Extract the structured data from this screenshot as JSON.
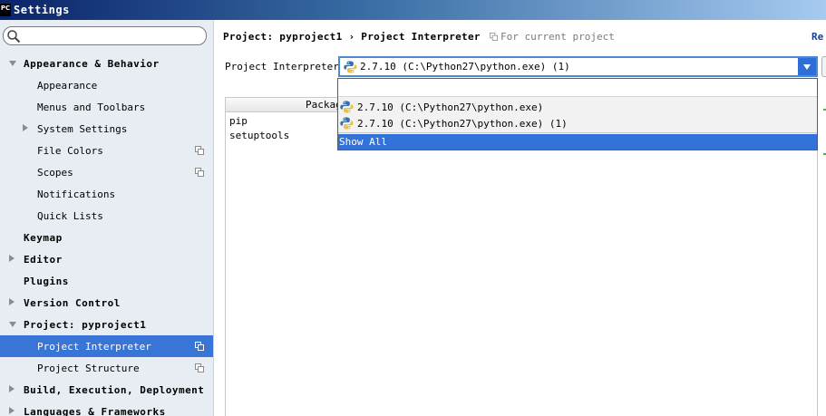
{
  "window": {
    "title": "Settings",
    "logo_text": "PC"
  },
  "sidebar": {
    "search": {
      "value": "",
      "placeholder": ""
    },
    "items": [
      {
        "label": "Appearance & Behavior",
        "level": 0,
        "expanded": true
      },
      {
        "label": "Appearance",
        "level": 1
      },
      {
        "label": "Menus and Toolbars",
        "level": 1
      },
      {
        "label": "System Settings",
        "level": 1,
        "collapsed": true
      },
      {
        "label": "File Colors",
        "level": 1,
        "project_scope": true
      },
      {
        "label": "Scopes",
        "level": 1,
        "project_scope": true
      },
      {
        "label": "Notifications",
        "level": 1
      },
      {
        "label": "Quick Lists",
        "level": 1
      },
      {
        "label": "Keymap",
        "level": 0
      },
      {
        "label": "Editor",
        "level": 0,
        "collapsed": true
      },
      {
        "label": "Plugins",
        "level": 0
      },
      {
        "label": "Version Control",
        "level": 0,
        "collapsed": true
      },
      {
        "label": "Project: pyproject1",
        "level": 0,
        "expanded": true
      },
      {
        "label": "Project Interpreter",
        "level": 1,
        "selected": true,
        "project_scope": true
      },
      {
        "label": "Project Structure",
        "level": 1,
        "project_scope": true
      },
      {
        "label": "Build, Execution, Deployment",
        "level": 0,
        "collapsed": true
      },
      {
        "label": "Languages & Frameworks",
        "level": 0,
        "collapsed": true
      }
    ]
  },
  "main": {
    "breadcrumb": "Project: pyproject1 › Project Interpreter",
    "scope_note": "For current project",
    "reset_label": "Re",
    "interpreter": {
      "label": "Project Interpreter:",
      "selected_value": "2.7.10 (C:\\Python27\\python.exe) (1)"
    },
    "dropdown": {
      "options": [
        "2.7.10 (C:\\Python27\\python.exe)",
        "2.7.10 (C:\\Python27\\python.exe) (1)"
      ],
      "show_all_label": "Show All"
    },
    "packages": {
      "column_header": "Packag",
      "rows": [
        "pip",
        "setuptools"
      ]
    }
  },
  "colors": {
    "selection": "#3875d7",
    "sidebar_bg": "#e8edf3",
    "accent_green": "#4caf50"
  }
}
